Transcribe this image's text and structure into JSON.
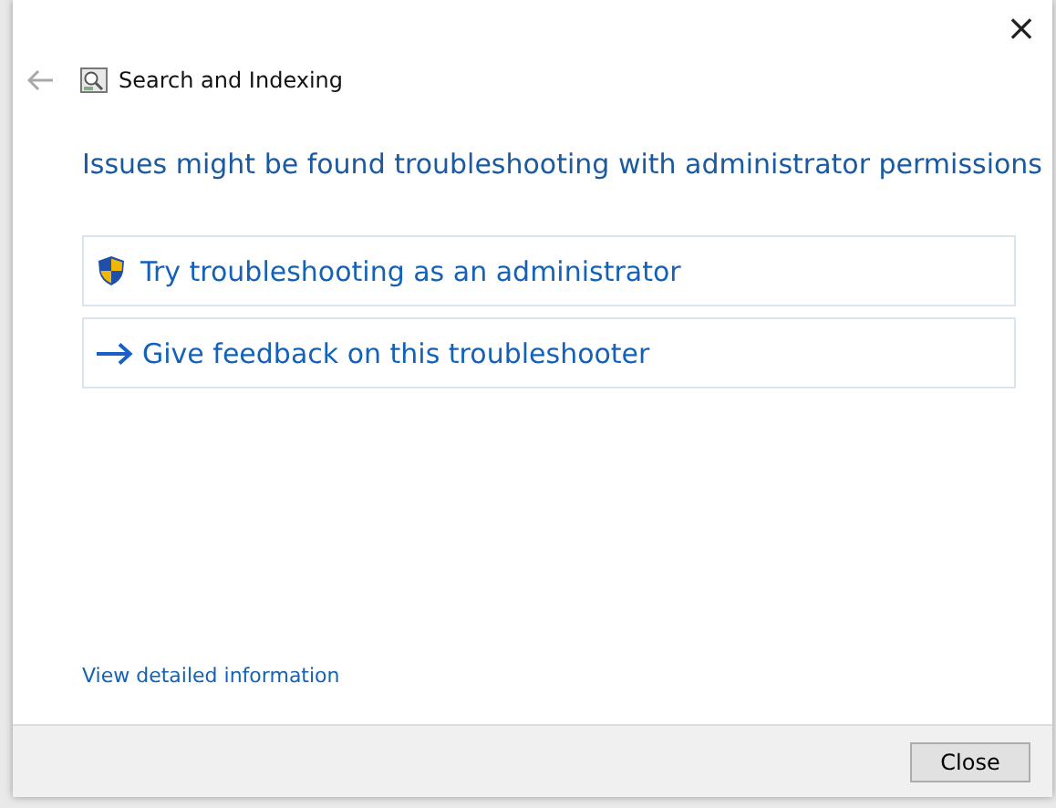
{
  "window": {
    "title": "Search and Indexing",
    "close_glyph": "×"
  },
  "heading": "Issues might be found troubleshooting with administrator permissions",
  "options": [
    {
      "kind": "admin",
      "label": "Try troubleshooting as an administrator"
    },
    {
      "kind": "feedback",
      "label": "Give feedback on this troubleshooter"
    }
  ],
  "details_link": "View detailed information",
  "buttons": [
    "Close"
  ]
}
